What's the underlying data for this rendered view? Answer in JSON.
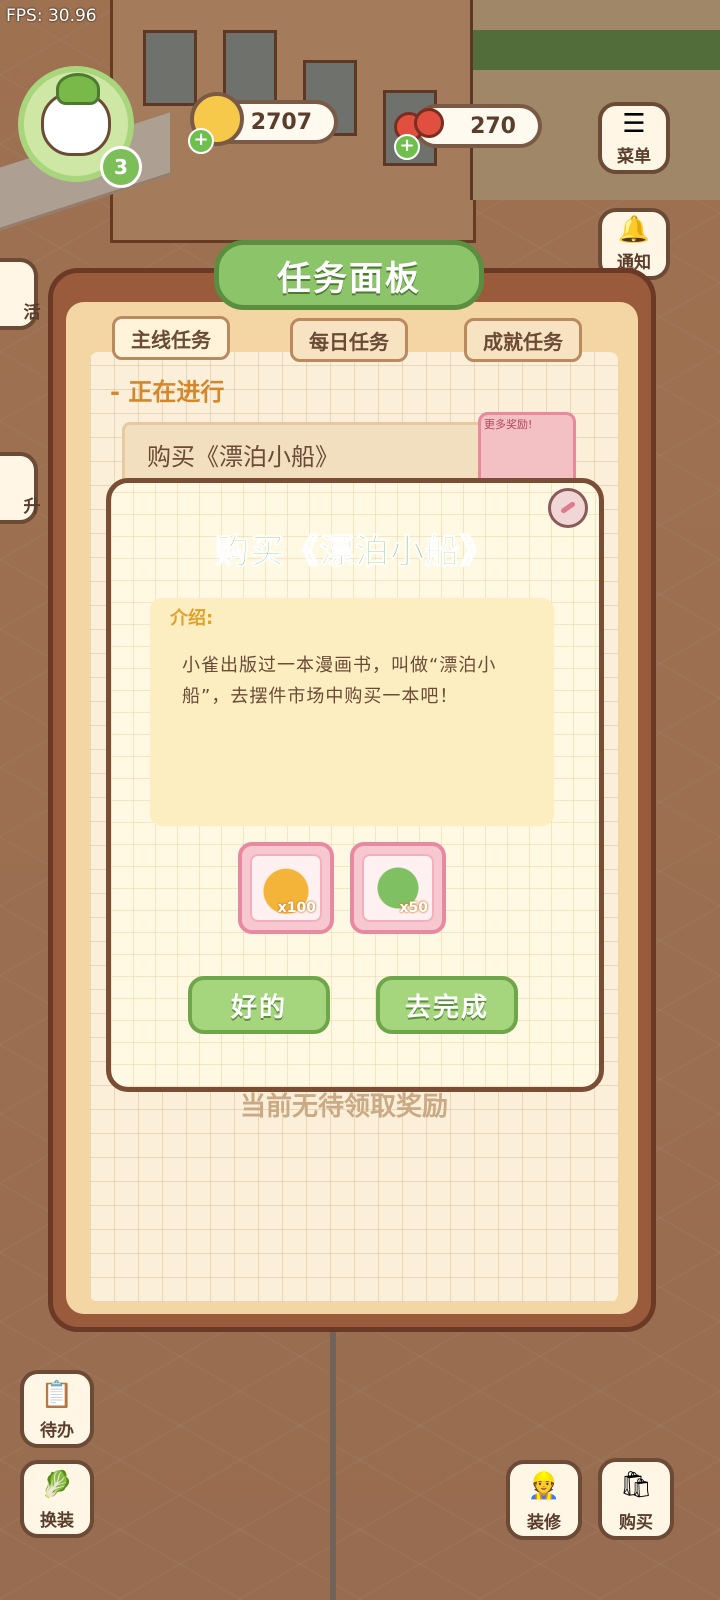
{
  "hud": {
    "fps": "FPS: 30.96",
    "level": "3",
    "coins": "2707",
    "cherries": "270",
    "plus": "+"
  },
  "side_right": [
    {
      "label": "菜单",
      "icon": "menu-icon"
    },
    {
      "label": "通知",
      "icon": "bell-icon"
    }
  ],
  "side_left_partial": [
    {
      "label": "活",
      "icon": "event-icon"
    },
    {
      "label": "升",
      "icon": "upgrade-icon"
    }
  ],
  "bottom": {
    "todo_label": "待办",
    "dress_label": "换装",
    "decorate_label": "装修",
    "shop_label": "购买"
  },
  "task_panel": {
    "title": "任务面板",
    "tabs": [
      {
        "label": "主线任务",
        "active": true
      },
      {
        "label": "每日任务",
        "active": false
      },
      {
        "label": "成就任务",
        "active": false
      }
    ],
    "section_label": "- 正在进行",
    "current_task": "购买《漂泊小船》",
    "more_rewards_label": "更多奖励!",
    "no_reward_text": "当前无待领取奖励"
  },
  "dialog": {
    "title": "购买《漂泊小船》",
    "intro_heading": "介绍:",
    "intro_text": "小雀出版过一本漫画书，叫做“漂泊小船”，去摆件市场中购买一本吧！",
    "rewards": [
      {
        "icon": "gold-nugget-icon",
        "qty": "x100"
      },
      {
        "icon": "green-upgrade-icon",
        "qty": "x50"
      }
    ],
    "ok_label": "好的",
    "go_label": "去完成"
  },
  "colors": {
    "accent_green": "#8cc46a",
    "panel_brown": "#9a5a3c",
    "section_orange": "#d3872a"
  }
}
